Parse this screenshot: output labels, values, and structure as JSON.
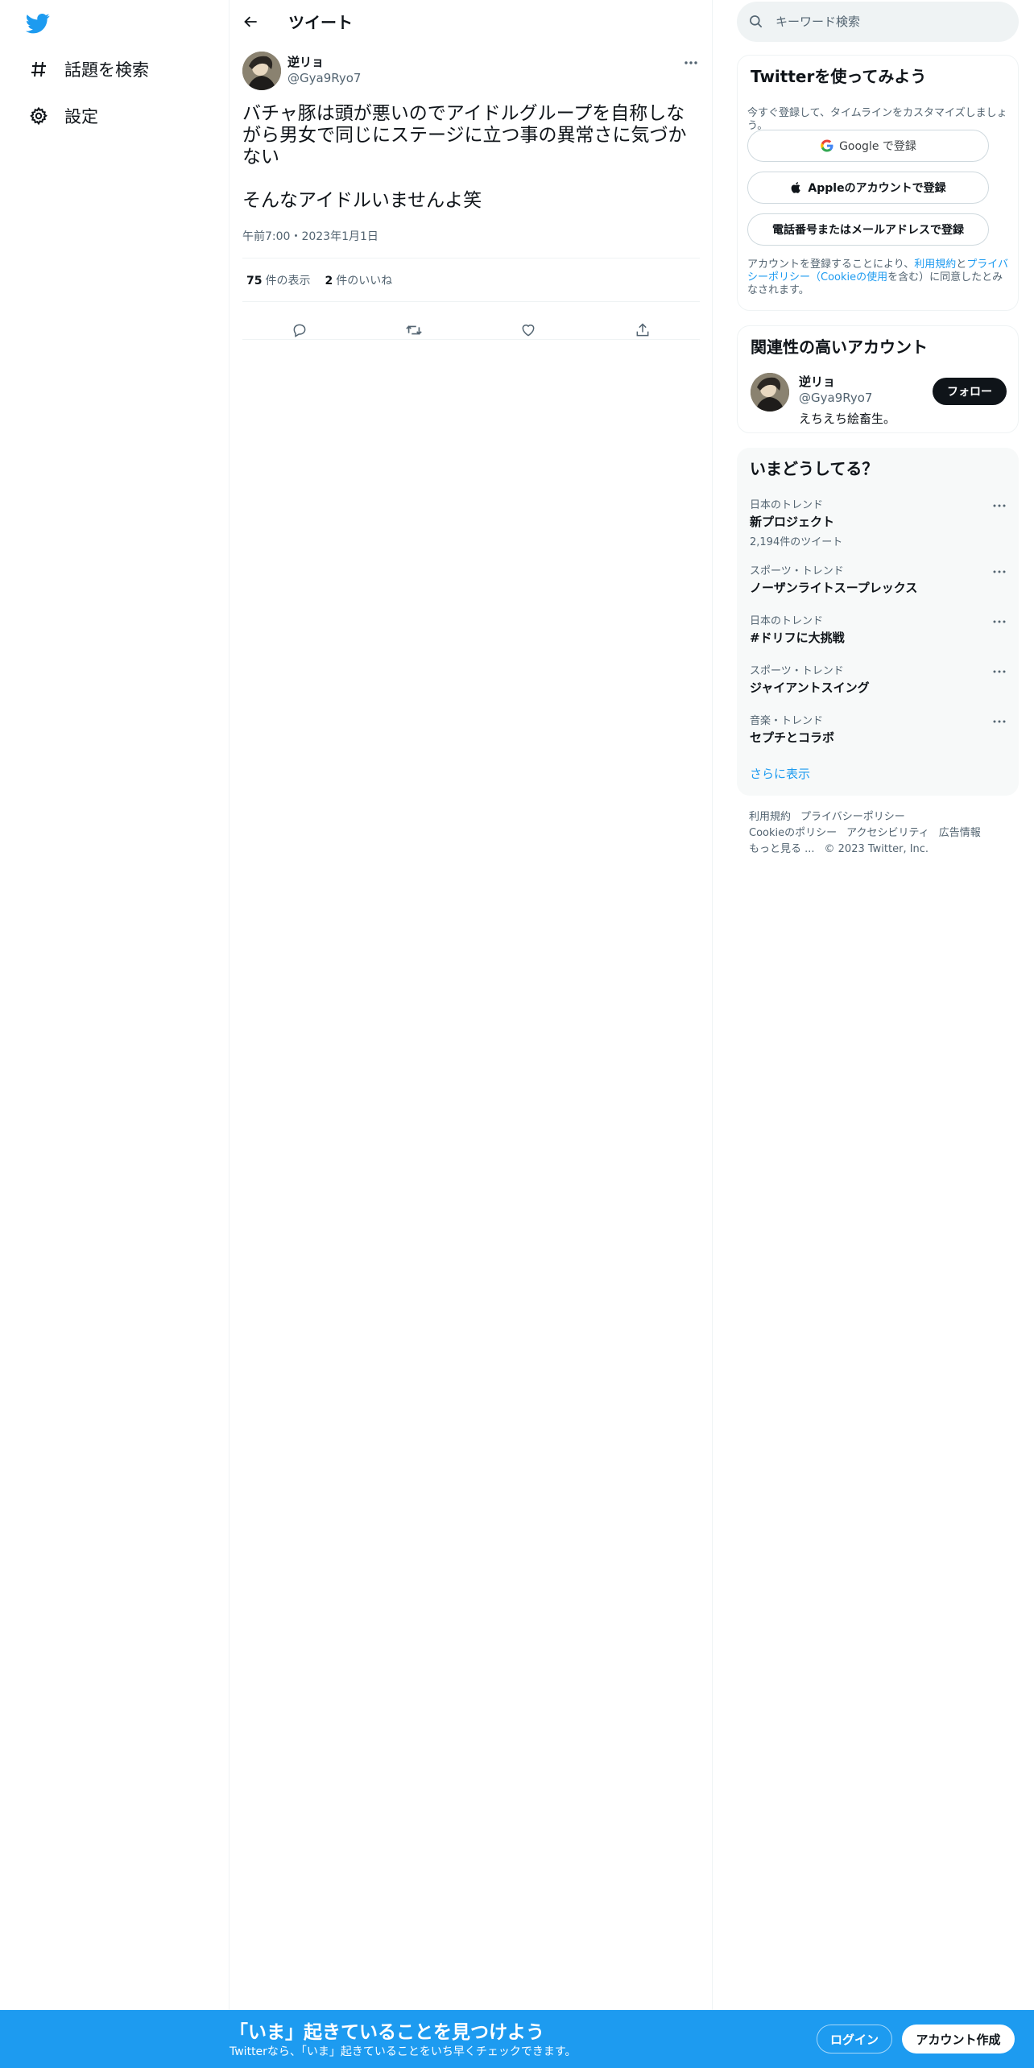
{
  "nav": {
    "logo": "twitter-bird-icon",
    "items": [
      {
        "label": "話題を検索",
        "icon": "hashtag-icon"
      },
      {
        "label": "設定",
        "icon": "gear-icon"
      }
    ]
  },
  "header": {
    "title": "ツイート"
  },
  "tweet": {
    "author_name": "逆リョ",
    "author_handle": "@Gya9Ryo7",
    "text": "バチャ豚は頭が悪いのでアイドルグループを自称しながら男女で同じにステージに立つ事の異常さに気づかない\n\nそんなアイドルいませんよ笑",
    "time": "午前7:00・2023年1月1日",
    "views_count": "75",
    "views_label": "件の表示",
    "likes_count": "2",
    "likes_label": "件のいいね"
  },
  "search": {
    "placeholder": "キーワード検索"
  },
  "signup_card": {
    "title": "Twitterを使ってみよう",
    "subtitle": "今すぐ登録して、タイムラインをカスタマイズしましょう。",
    "google_label": "Google で登録",
    "apple_label": "Appleのアカウントで登録",
    "phone_label": "電話番号またはメールアドレスで登録",
    "legal_prefix": "アカウントを登録することにより、",
    "legal_terms": "利用規約",
    "legal_and": "と",
    "legal_privacy": "プライバシーポリシー（Cookieの使用",
    "legal_suffix": "を含む）に同意したとみなされます。"
  },
  "relevant": {
    "title": "関連性の高いアカウント",
    "name": "逆リョ",
    "handle": "@Gya9Ryo7",
    "bio": "えちえち絵畜生。",
    "follow_label": "フォロー"
  },
  "trends": {
    "title": "いまどうしてる？",
    "items": [
      {
        "category": "日本のトレンド",
        "name": "新プロジェクト",
        "count": "2,194件のツイート"
      },
      {
        "category": "スポーツ・トレンド",
        "name": "ノーザンライトスープレックス",
        "count": ""
      },
      {
        "category": "日本のトレンド",
        "name": "#ドリフに大挑戦",
        "count": ""
      },
      {
        "category": "スポーツ・トレンド",
        "name": "ジャイアントスイング",
        "count": ""
      },
      {
        "category": "音楽・トレンド",
        "name": "セプチとコラボ",
        "count": ""
      }
    ],
    "show_more": "さらに表示"
  },
  "footer": {
    "terms": "利用規約",
    "privacy": "プライバシーポリシー",
    "cookie": "Cookieのポリシー",
    "accessibility": "アクセシビリティ",
    "ads": "広告情報",
    "more": "もっと見る ...",
    "copyright": "© 2023 Twitter, Inc."
  },
  "banner": {
    "title": "「いま」起きていることを見つけよう",
    "subtitle": "Twitterなら、「いま」起きていることをいち早くチェックできます。",
    "login_label": "ログイン",
    "signup_label": "アカウント作成"
  },
  "colors": {
    "accent": "#1d9bf0",
    "text": "#0f1419",
    "muted": "#536471",
    "border": "#eff3f4"
  }
}
